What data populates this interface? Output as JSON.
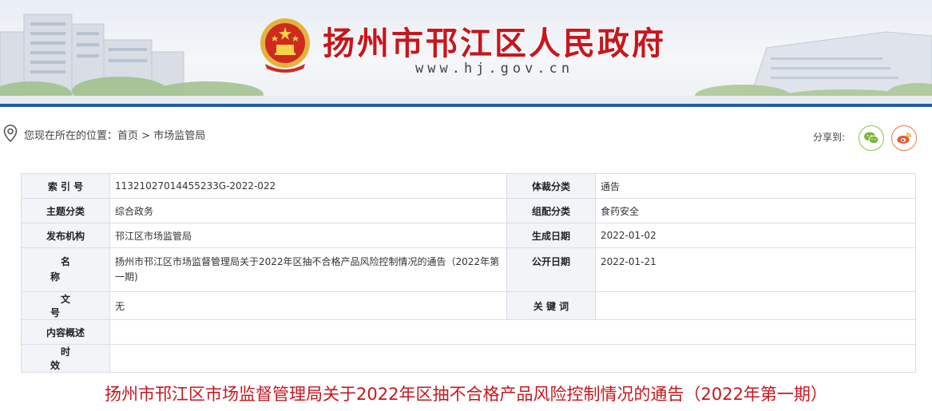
{
  "header": {
    "site_title": "扬州市邗江区人民政府",
    "site_url": "www.hj.gov.cn",
    "accent_color": "#c8161d"
  },
  "breadcrumb": {
    "prefix": "您现在所在的位置：",
    "home": "首页",
    "separator": ">",
    "current": "市场监管局"
  },
  "share": {
    "label": "分享到:",
    "buttons": [
      "wechat-icon",
      "weibo-icon"
    ]
  },
  "meta": {
    "index_no_label": "索 引 号",
    "index_no": "11321027014455233G-2022-022",
    "genre_label": "体裁分类",
    "genre": "通告",
    "topic_label": "主题分类",
    "topic": "综合政务",
    "category_label": "组配分类",
    "category": "食药安全",
    "publisher_label": "发布机构",
    "publisher": "邗江区市场监管局",
    "created_label": "生成日期",
    "created": "2022-01-02",
    "name_label": "名称",
    "name": "扬州市邗江区市场监督管理局关于2022年区抽不合格产品风险控制情况的通告（2022年第一期)",
    "published_label": "公开日期",
    "published": "2022-01-21",
    "doc_no_label": "文号",
    "doc_no": "无",
    "keywords_label": "关 键 词",
    "keywords": "",
    "summary_label": "内容概述",
    "summary": "",
    "validity_label": "时效",
    "validity": ""
  },
  "article": {
    "title": "扬州市邗江区市场监督管理局关于2022年区抽不合格产品风险控制情况的通告（2022年第一期）"
  }
}
